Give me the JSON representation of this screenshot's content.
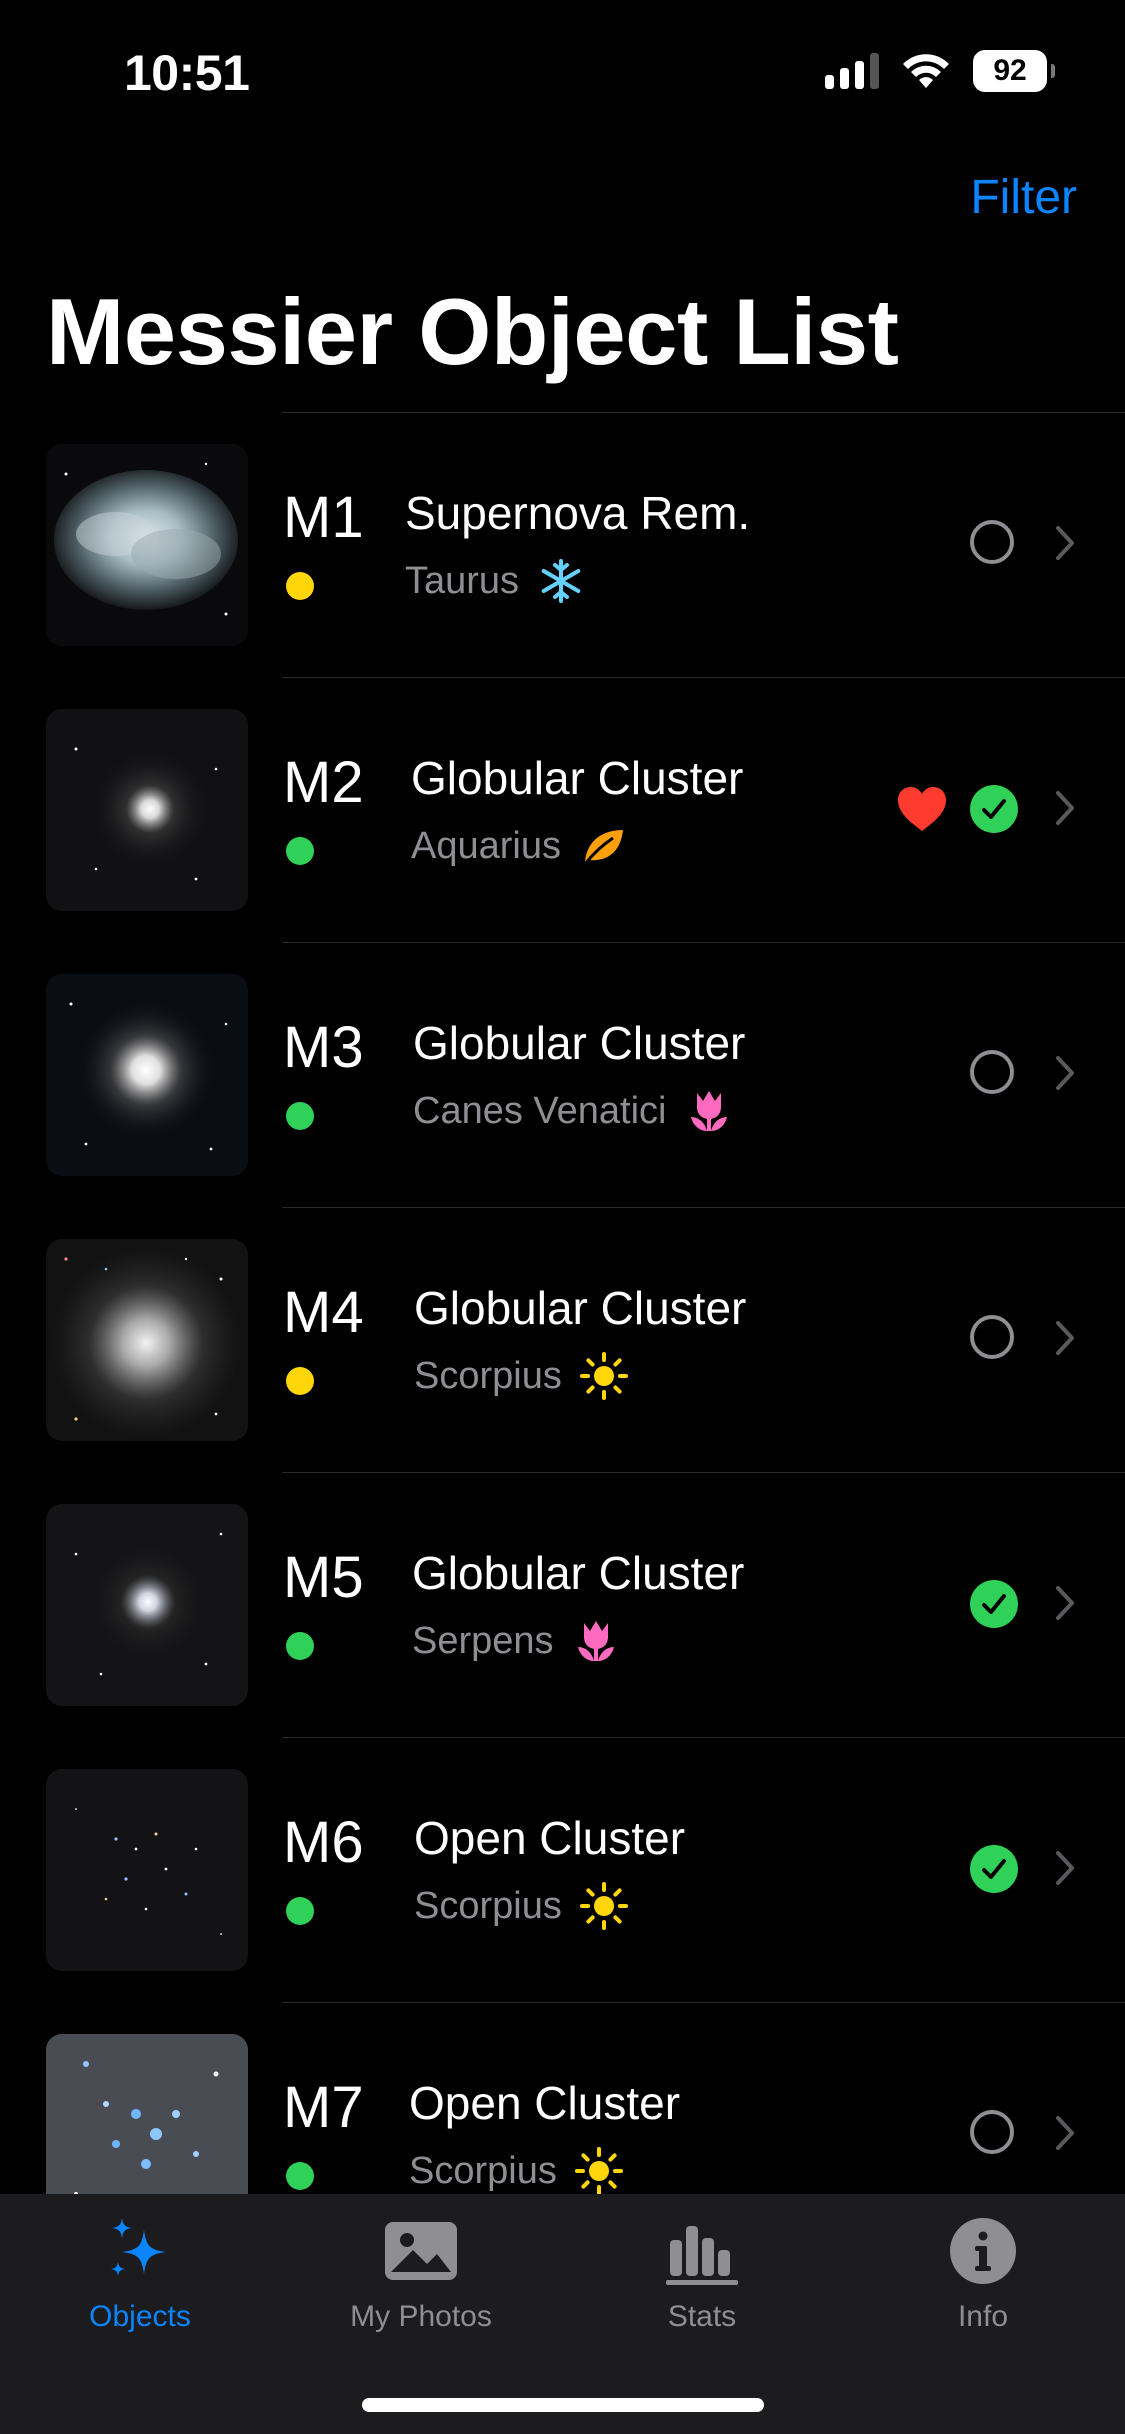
{
  "status_bar": {
    "time": "10:51",
    "battery": "92"
  },
  "nav": {
    "filter_label": "Filter",
    "title": "Messier Object List"
  },
  "colors": {
    "accent": "#0a84ff",
    "green": "#30d158",
    "yellow": "#ffd60a",
    "heart": "#ff3b30",
    "secondary_text": "#8e8e93"
  },
  "objects": [
    {
      "id": "M1",
      "type": "Supernova Rem.",
      "constellation": "Taurus",
      "season_icon": "snowflake-icon",
      "dot_color": "yellow",
      "observed": false,
      "favorite": false
    },
    {
      "id": "M2",
      "type": "Globular Cluster",
      "constellation": "Aquarius",
      "season_icon": "leaf-icon",
      "dot_color": "green",
      "observed": true,
      "favorite": true
    },
    {
      "id": "M3",
      "type": "Globular Cluster",
      "constellation": "Canes Venatici",
      "season_icon": "tulip-icon",
      "dot_color": "green",
      "observed": false,
      "favorite": false
    },
    {
      "id": "M4",
      "type": "Globular Cluster",
      "constellation": "Scorpius",
      "season_icon": "sun-icon",
      "dot_color": "yellow",
      "observed": false,
      "favorite": false
    },
    {
      "id": "M5",
      "type": "Globular Cluster",
      "constellation": "Serpens",
      "season_icon": "tulip-icon",
      "dot_color": "green",
      "observed": true,
      "favorite": false
    },
    {
      "id": "M6",
      "type": "Open Cluster",
      "constellation": "Scorpius",
      "season_icon": "sun-icon",
      "dot_color": "green",
      "observed": true,
      "favorite": false
    },
    {
      "id": "M7",
      "type": "Open Cluster",
      "constellation": "Scorpius",
      "season_icon": "sun-icon",
      "dot_color": "green",
      "observed": false,
      "favorite": false
    }
  ],
  "tabs": [
    {
      "label": "Objects",
      "icon": "sparkles-icon",
      "active": true
    },
    {
      "label": "My Photos",
      "icon": "photo-icon",
      "active": false
    },
    {
      "label": "Stats",
      "icon": "bar-chart-icon",
      "active": false
    },
    {
      "label": "Info",
      "icon": "info-icon",
      "active": false
    }
  ]
}
